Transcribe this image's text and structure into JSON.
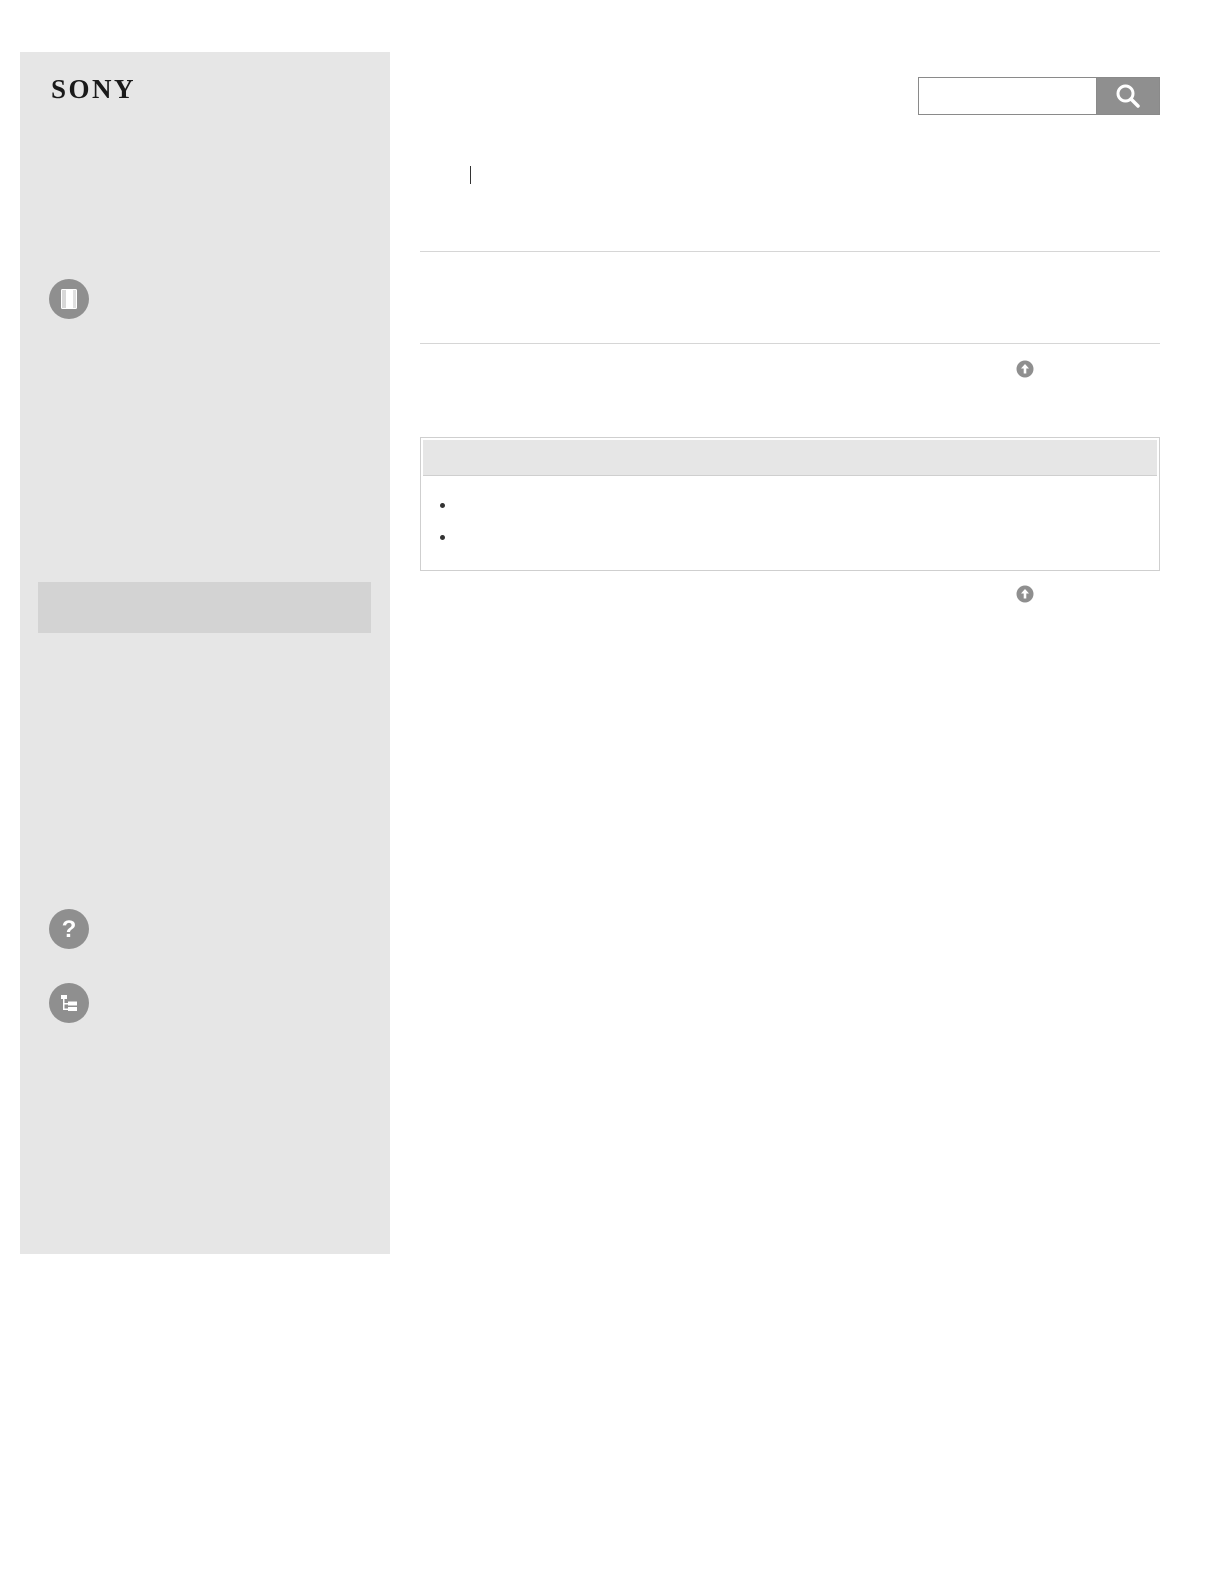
{
  "brand": {
    "logo_text": "SONY"
  },
  "search": {
    "placeholder": "",
    "value": "",
    "button_icon": "search-icon"
  },
  "breadcrumb": {
    "items": []
  },
  "page": {
    "title": ""
  },
  "sidebar": {
    "items": [
      {
        "icon": "manual-icon",
        "label": ""
      },
      {
        "icon": "help-icon",
        "label": ""
      },
      {
        "icon": "sitemap-icon",
        "label": ""
      }
    ],
    "highlighted_label": ""
  },
  "note": {
    "header": "",
    "items": [
      "",
      ""
    ]
  },
  "back_to_top": {
    "icon": "arrow-up-circle-icon"
  },
  "colors": {
    "sidebar_bg": "#e6e6e6",
    "highlight_bg": "#d3d3d3",
    "icon_gray": "#8f8f8f",
    "divider": "#d6d6d6"
  }
}
